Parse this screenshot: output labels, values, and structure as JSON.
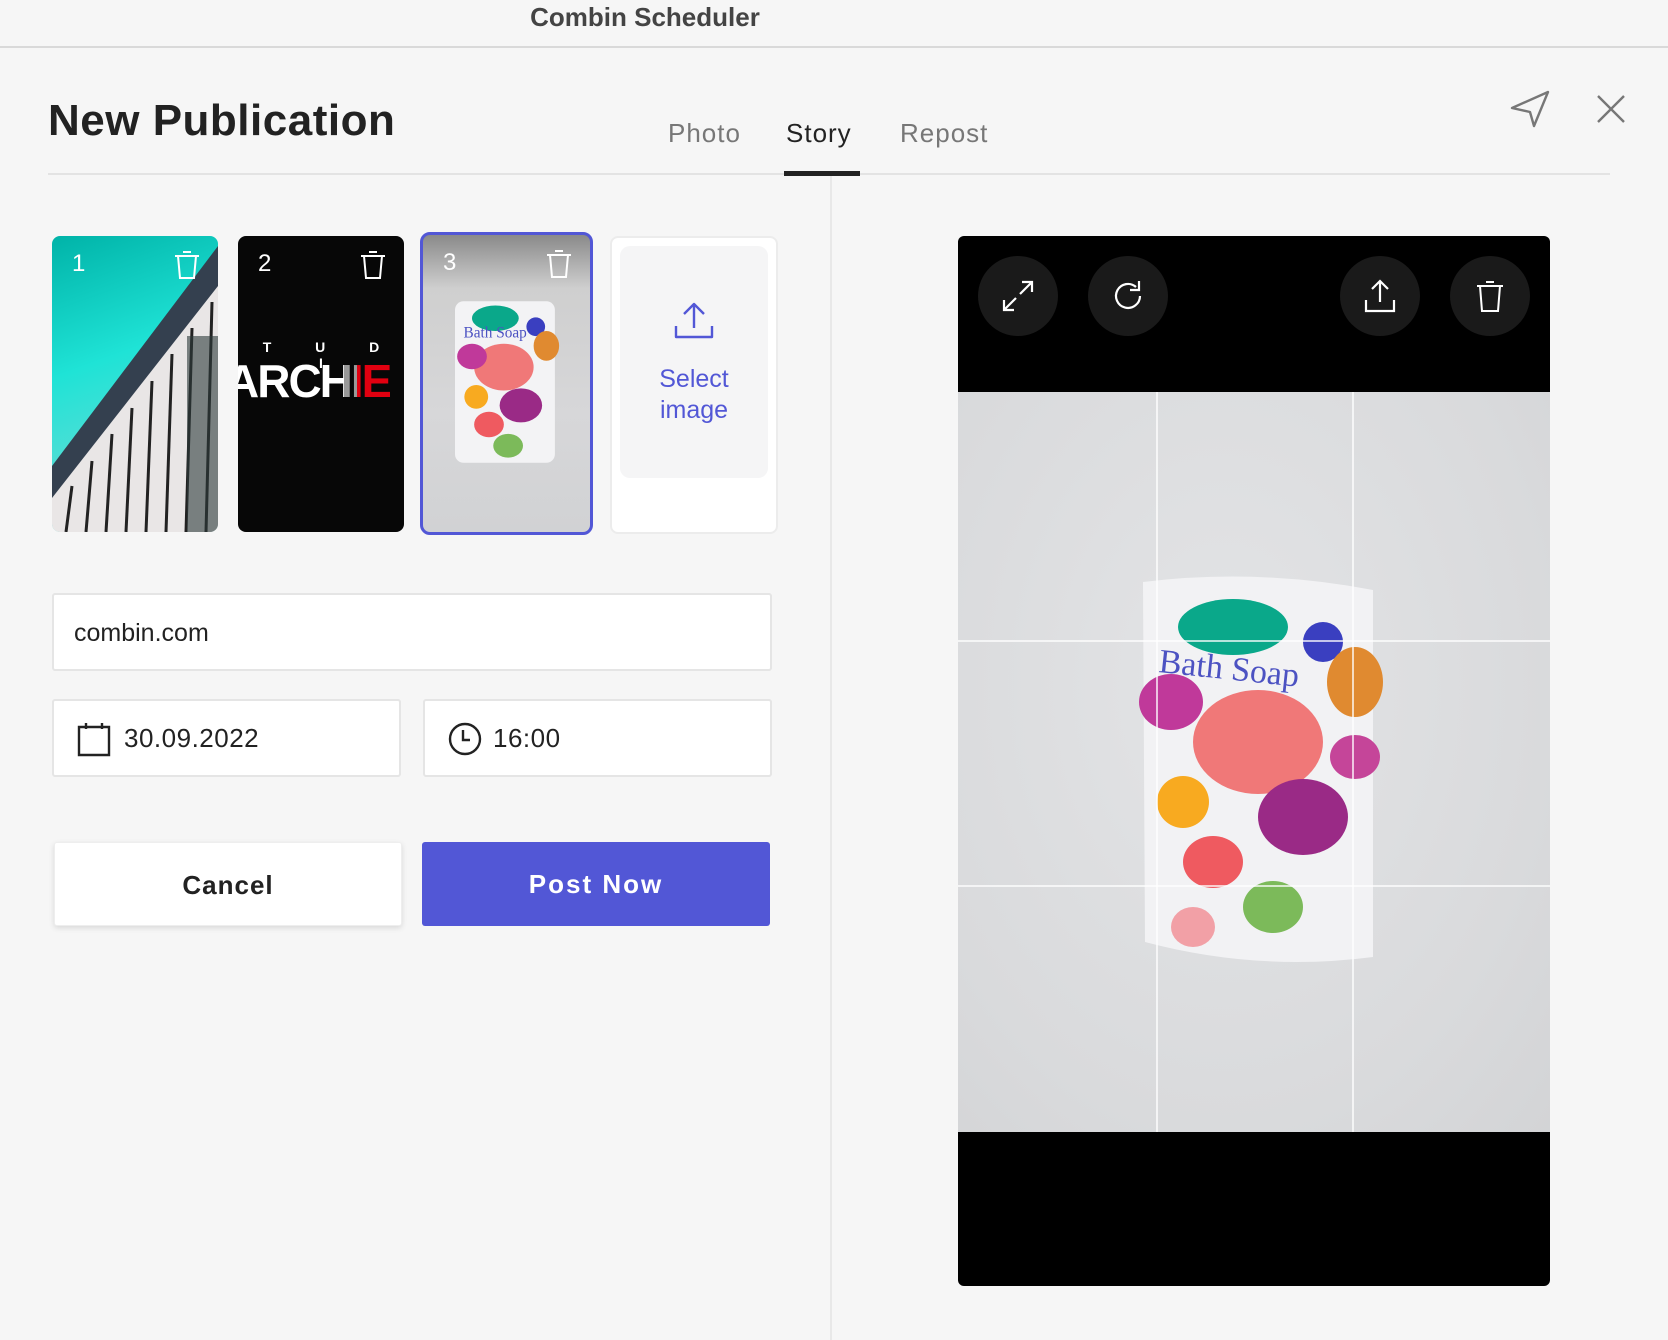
{
  "window": {
    "title": "Combin Scheduler"
  },
  "header": {
    "title": "New Publication",
    "tabs": [
      {
        "label": "Photo",
        "active": false
      },
      {
        "label": "Story",
        "active": true
      },
      {
        "label": "Repost",
        "active": false
      }
    ],
    "actions": {
      "send_icon": "send-icon",
      "close_icon": "close-icon"
    }
  },
  "media": {
    "items": [
      {
        "index": "1",
        "description": "building facade against teal sky"
      },
      {
        "index": "2",
        "description": "Studio Archie logo on black"
      },
      {
        "index": "3",
        "description": "Bath Soap package",
        "selected": true
      }
    ],
    "select_label_line1": "Select",
    "select_label_line2": "image"
  },
  "form": {
    "url_value": "combin.com",
    "date_value": "30.09.2022",
    "time_value": "16:00"
  },
  "buttons": {
    "cancel": "Cancel",
    "post_now": "Post Now"
  },
  "preview": {
    "product_text": "Bath Soap",
    "thumb2_text_top": "T U D I",
    "thumb2_text_main": "ARCHIE",
    "controls": [
      "expand-icon",
      "rotate-icon",
      "upload-icon",
      "trash-icon"
    ]
  },
  "colors": {
    "accent": "#5257d6",
    "background": "#f6f6f6",
    "text": "#222222"
  }
}
